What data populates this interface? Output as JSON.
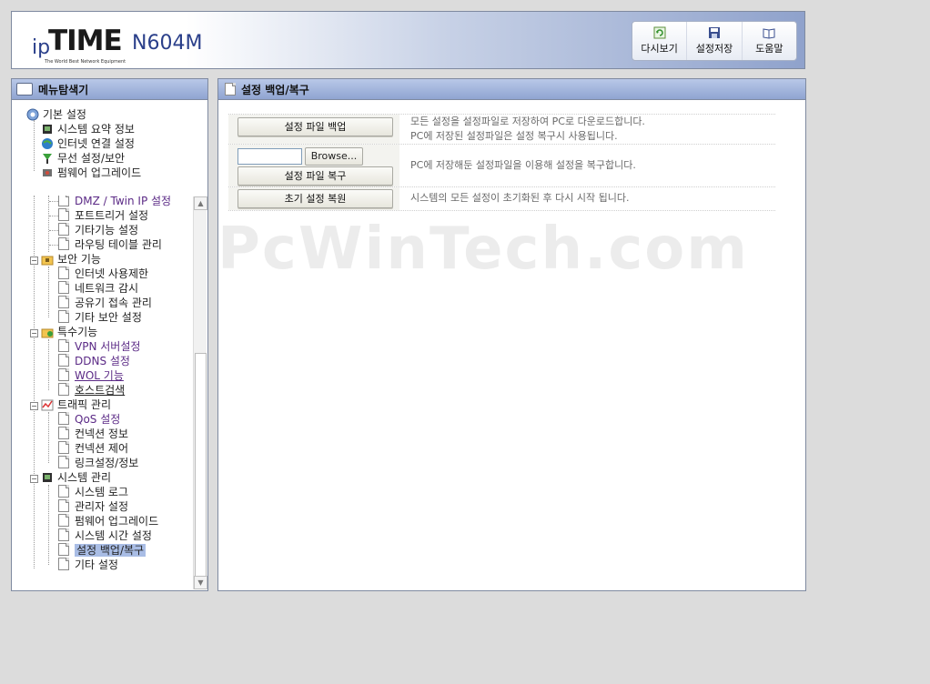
{
  "header": {
    "logo_ip": "ip",
    "logo_time": "TIME",
    "logo_model": "N604M",
    "logo_tagline": "The World Best Network Equipment",
    "toolbar": [
      {
        "label": "다시보기",
        "icon": "refresh-icon"
      },
      {
        "label": "설정저장",
        "icon": "save-disk-icon"
      },
      {
        "label": "도움말",
        "icon": "book-icon"
      }
    ]
  },
  "sidebar": {
    "title": "메뉴탐색기",
    "top_tree": {
      "root": "기본 설정",
      "items": [
        "시스템 요약 정보",
        "인터넷 연결 설정",
        "무선 설정/보안",
        "펌웨어 업그레이드"
      ]
    },
    "advanced_tree": {
      "network_items": [
        "DMZ / Twin IP 설정",
        "포트트리거 설정",
        "기타기능 설정",
        "라우팅 테이블 관리"
      ],
      "groups": [
        {
          "label": "보안 기능",
          "items": [
            "인터넷 사용제한",
            "네트워크 감시",
            "공유기 접속 관리",
            "기타 보안 설정"
          ]
        },
        {
          "label": "특수기능",
          "items": [
            "VPN 서버설정",
            "DDNS 설정",
            "WOL 기능",
            "호스트검색"
          ]
        },
        {
          "label": "트래픽 관리",
          "items": [
            "QoS 설정",
            "컨넥션 정보",
            "컨넥션 제어",
            "링크설정/정보"
          ]
        },
        {
          "label": "시스템 관리",
          "items": [
            "시스템 로그",
            "관리자 설정",
            "펌웨어 업그레이드",
            "시스템 시간 설정",
            "설정 백업/복구",
            "기타 설정"
          ]
        }
      ],
      "selected": "설정 백업/복구"
    }
  },
  "main": {
    "title": "설정 백업/복구",
    "backup_button": "설정 파일 백업",
    "backup_desc_line1": "모든 설정을 설정파일로 저장하여 PC로 다운로드합니다.",
    "backup_desc_line2": "PC에 저장된 설정파일은 설정 복구시 사용됩니다.",
    "browse_button": "Browse...",
    "restore_button": "설정 파일 복구",
    "restore_desc": "PC에 저장해둔 설정파일을 이용해 설정을 복구합니다.",
    "factory_button": "초기 설정 복원",
    "factory_desc": "시스템의 모든 설정이 초기화된 후 다시 시작 됩니다.",
    "watermark": "PcWinTech.com"
  },
  "colors": {
    "title_bar": "#9fb1db",
    "selected_item": "#a9bde5",
    "background": "#dcdcdc"
  }
}
